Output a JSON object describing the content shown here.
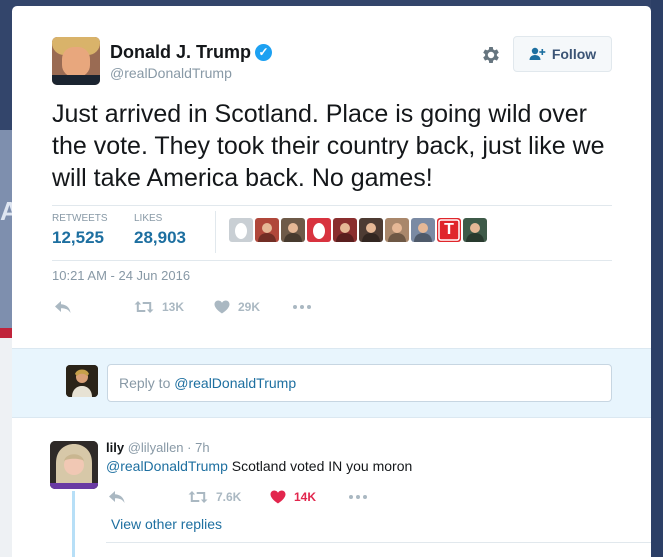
{
  "tweet": {
    "author_name": "Donald J. Trump",
    "author_handle": "@realDonaldTrump",
    "text": "Just arrived in Scotland. Place is going wild over the vote. They took their country back, just like we will take America back. No games!",
    "follow_label": "Follow",
    "stats": {
      "retweets_label": "RETWEETS",
      "retweets_value": "12,525",
      "likes_label": "LIKES",
      "likes_value": "28,903"
    },
    "timestamp": "10:21 AM - 24 Jun 2016",
    "actions": {
      "retweet_count": "13K",
      "like_count": "29K"
    }
  },
  "liker_faces": [
    {
      "icon": "egg-avatar",
      "bg": "#c9cfd4"
    },
    {
      "icon": "user-avatar",
      "bg": "#b0473a"
    },
    {
      "icon": "user-avatar",
      "bg": "#6e5a48"
    },
    {
      "icon": "egg-avatar",
      "bg": "#d8333f"
    },
    {
      "icon": "user-avatar",
      "bg": "#8a2e2e"
    },
    {
      "icon": "user-avatar",
      "bg": "#4d3b33"
    },
    {
      "icon": "user-avatar",
      "bg": "#a9876b"
    },
    {
      "icon": "user-avatar",
      "bg": "#7a8aa3"
    },
    {
      "icon": "letter-t-avatar",
      "bg": "#e0262b",
      "letter": "T"
    },
    {
      "icon": "user-avatar",
      "bg": "#3e5a48"
    }
  ],
  "reply_box": {
    "prefix": "Reply to ",
    "mention": "@realDonaldTrump"
  },
  "reply": {
    "name": "lily",
    "meta": "@lilyallen · 7h",
    "mention": "@realDonaldTrump",
    "text": " Scotland voted IN you moron",
    "retweet_count": "7.6K",
    "like_count": "14K",
    "view_other_replies": "View other replies"
  },
  "background": {
    "letter": "A"
  },
  "colors": {
    "accent": "#1d6fa0",
    "verified": "#1da1f2",
    "like_active": "#e2264d",
    "muted": "#8899a6"
  }
}
